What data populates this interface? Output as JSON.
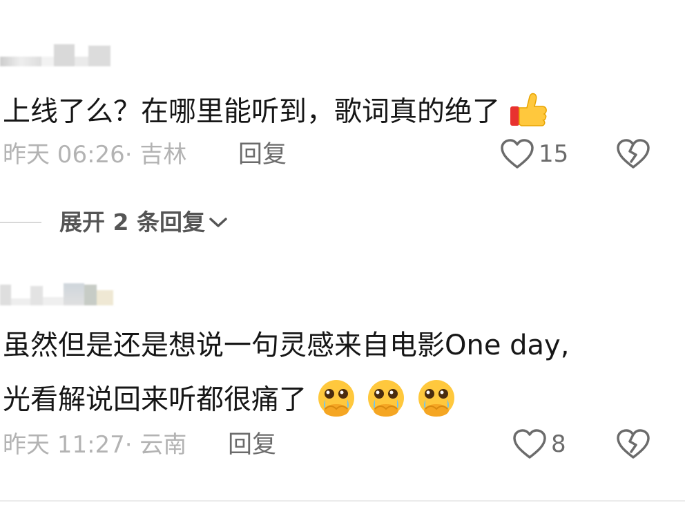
{
  "comments": [
    {
      "text": "上线了么？在哪里能听到，歌词真的绝了",
      "emoji": "thumbs-up",
      "time": "昨天 06:26·",
      "location": "吉林",
      "reply_label": "回复",
      "like_count": "15"
    },
    {
      "text_line1": "虽然但是还是想说一句灵感来自电影One day,",
      "text_line2": "光看解说回来听都很痛了",
      "emoji": "crying-face",
      "time": "昨天 11:27·",
      "location": "云南",
      "reply_label": "回复",
      "like_count": "8"
    }
  ],
  "expand": {
    "label": "展开 2 条回复"
  },
  "colors": {
    "text": "#161616",
    "meta": "#b3b3b3",
    "action": "#6b6b6b",
    "emoji_yellow": "#ffc83d",
    "thumb_cuff": "#e8322f"
  }
}
